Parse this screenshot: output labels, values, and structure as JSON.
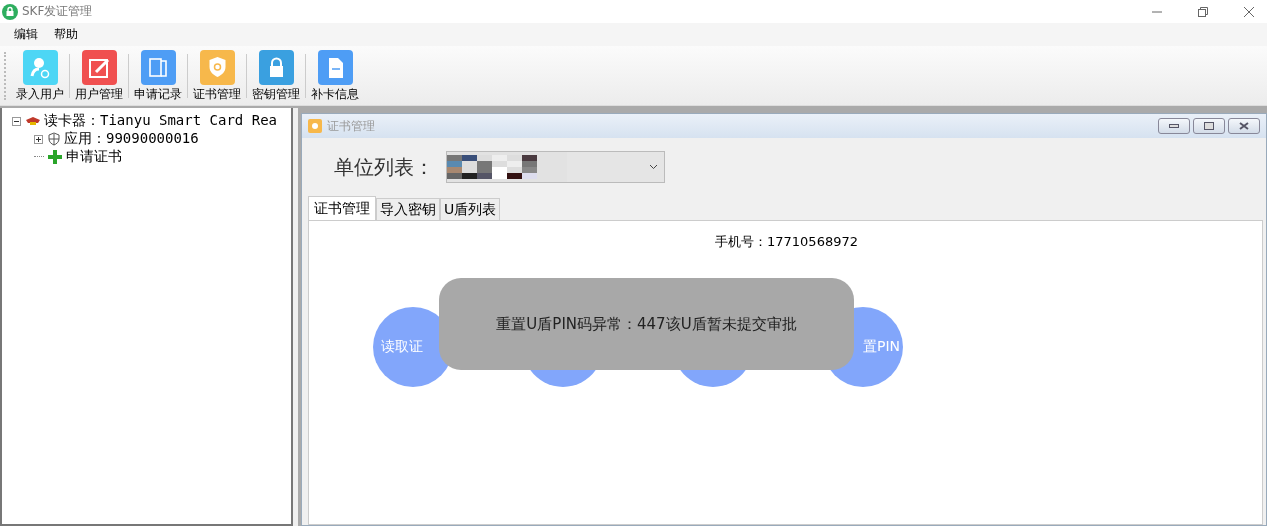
{
  "window": {
    "title": "SKF发证管理"
  },
  "menu": [
    "编辑",
    "帮助"
  ],
  "toolbar": [
    {
      "label": "录入用户",
      "kind": "user",
      "color": "#4dd6f5"
    },
    {
      "label": "用户管理",
      "kind": "edit",
      "color": "#f05050"
    },
    {
      "label": "申请记录",
      "kind": "docs",
      "color": "#4e9df5"
    },
    {
      "label": "证书管理",
      "kind": "shield",
      "color": "#f7b84b"
    },
    {
      "label": "密钥管理",
      "kind": "lock",
      "color": "#3aa0e0"
    },
    {
      "label": "补卡信息",
      "kind": "card",
      "color": "#4e9df5"
    }
  ],
  "tree": [
    {
      "label": "读卡器：Tianyu Smart Card Rea",
      "kind": "reader",
      "expanded": true,
      "children": [
        {
          "label": "应用：99090000016",
          "kind": "app",
          "expanded": false
        },
        {
          "label": "申请证书",
          "kind": "add"
        }
      ]
    }
  ],
  "child_window": {
    "title": "证书管理",
    "unit_label": "单位列表：",
    "tabs": [
      {
        "label": "证书管理",
        "selected": true
      },
      {
        "label": "导入密钥",
        "selected": false
      },
      {
        "label": "U盾列表",
        "selected": false
      }
    ],
    "phone": "手机号：17710568972",
    "circles": [
      {
        "kind": "labeled",
        "label": "读取证"
      },
      {
        "kind": "plain"
      },
      {
        "kind": "plain"
      },
      {
        "kind": "labeled",
        "label": "置PIN"
      }
    ],
    "toast": "重置U盾PIN码异常：447该U盾暂未提交审批"
  }
}
